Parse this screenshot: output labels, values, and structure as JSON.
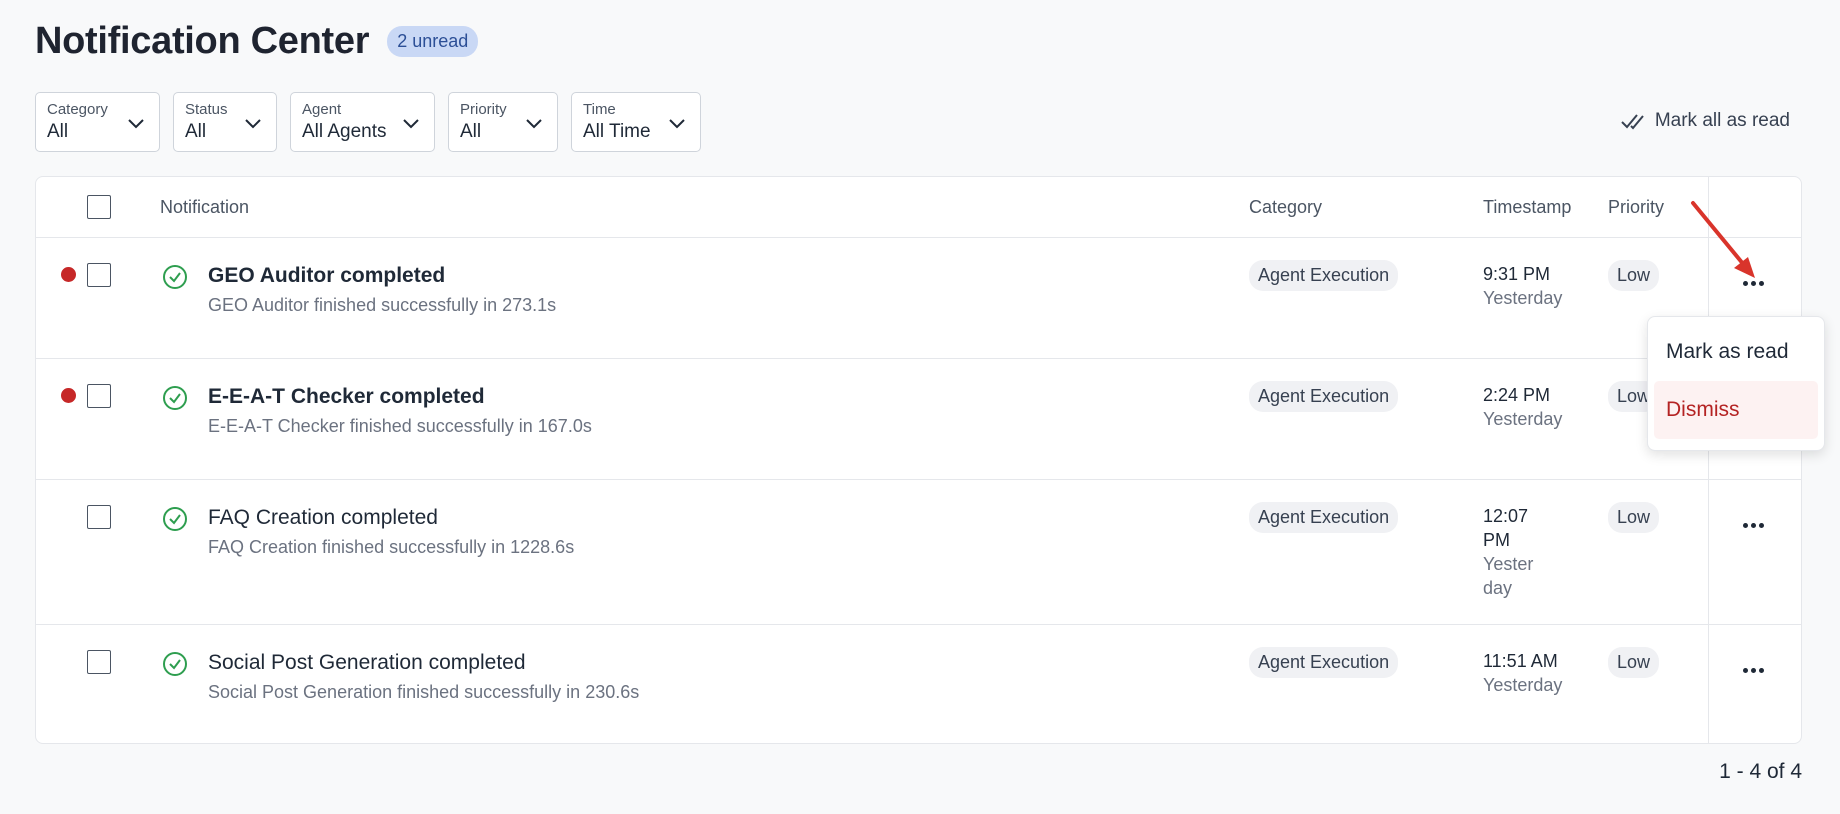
{
  "header": {
    "title": "Notification Center",
    "unread_badge": "2 unread"
  },
  "filters": [
    {
      "label": "Category",
      "value": "All"
    },
    {
      "label": "Status",
      "value": "All"
    },
    {
      "label": "Agent",
      "value": "All Agents"
    },
    {
      "label": "Priority",
      "value": "All"
    },
    {
      "label": "Time",
      "value": "All Time"
    }
  ],
  "actions": {
    "mark_all": "Mark all as read"
  },
  "table": {
    "columns": {
      "notification": "Notification",
      "category": "Category",
      "timestamp": "Timestamp",
      "priority": "Priority"
    },
    "rows": [
      {
        "title": "GEO Auditor completed",
        "subtitle": "GEO Auditor finished successfully in 273.1s",
        "category": "Agent Execution",
        "time": "9:31 PM",
        "day": "Yesterday",
        "priority": "Low",
        "unread": true
      },
      {
        "title": "E-E-A-T Checker completed",
        "subtitle": "E-E-A-T Checker finished successfully in 167.0s",
        "category": "Agent Execution",
        "time": "2:24 PM",
        "day": "Yesterday",
        "priority": "Low",
        "unread": true
      },
      {
        "title": "FAQ Creation completed",
        "subtitle": "FAQ Creation finished successfully in 1228.6s",
        "category": "Agent Execution",
        "time": "12:07 PM",
        "day": "Yesterday",
        "priority": "Low",
        "unread": false
      },
      {
        "title": "Social Post Generation completed",
        "subtitle": "Social Post Generation finished successfully in 230.6s",
        "category": "Agent Execution",
        "time": "11:51 AM",
        "day": "Yesterday",
        "priority": "Low",
        "unread": false
      }
    ]
  },
  "row_menu": {
    "mark_as_read": "Mark as read",
    "dismiss": "Dismiss"
  },
  "pagination": {
    "text": "1 - 4 of 4"
  },
  "colors": {
    "unread_dot": "#c62828",
    "success_icon": "#2e9e4f",
    "dismiss": "#b42323",
    "annotation_arrow": "#d9342b",
    "badge_bg": "#c9d8f5"
  },
  "icons": {
    "status": "check-circle-icon",
    "filter": "chevron-down-icon",
    "mark_all": "double-check-icon",
    "row_actions": "more-horizontal-icon"
  }
}
